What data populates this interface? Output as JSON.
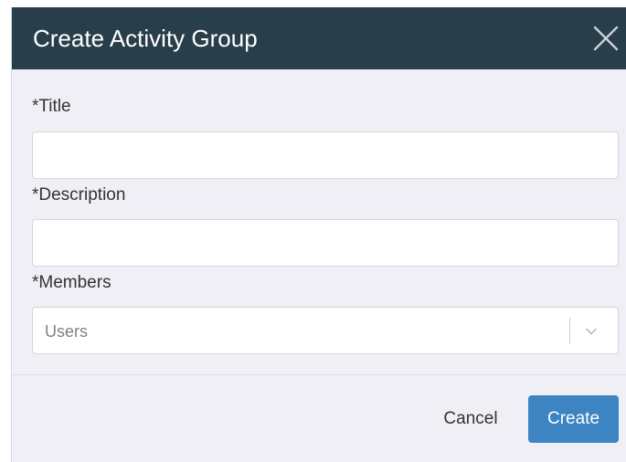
{
  "dialog": {
    "title": "Create Activity Group",
    "close_icon": "close-icon"
  },
  "form": {
    "title_label": "*Title",
    "title_value": "",
    "description_label": "*Description",
    "description_value": "",
    "members_label": "*Members",
    "members_placeholder": "Users",
    "members_dropdown_icon": "chevron-down-icon"
  },
  "footer": {
    "cancel_label": "Cancel",
    "create_label": "Create"
  },
  "colors": {
    "header_bg": "#283e4a",
    "body_bg": "#f0eff5",
    "primary_button": "#3c84c2"
  }
}
